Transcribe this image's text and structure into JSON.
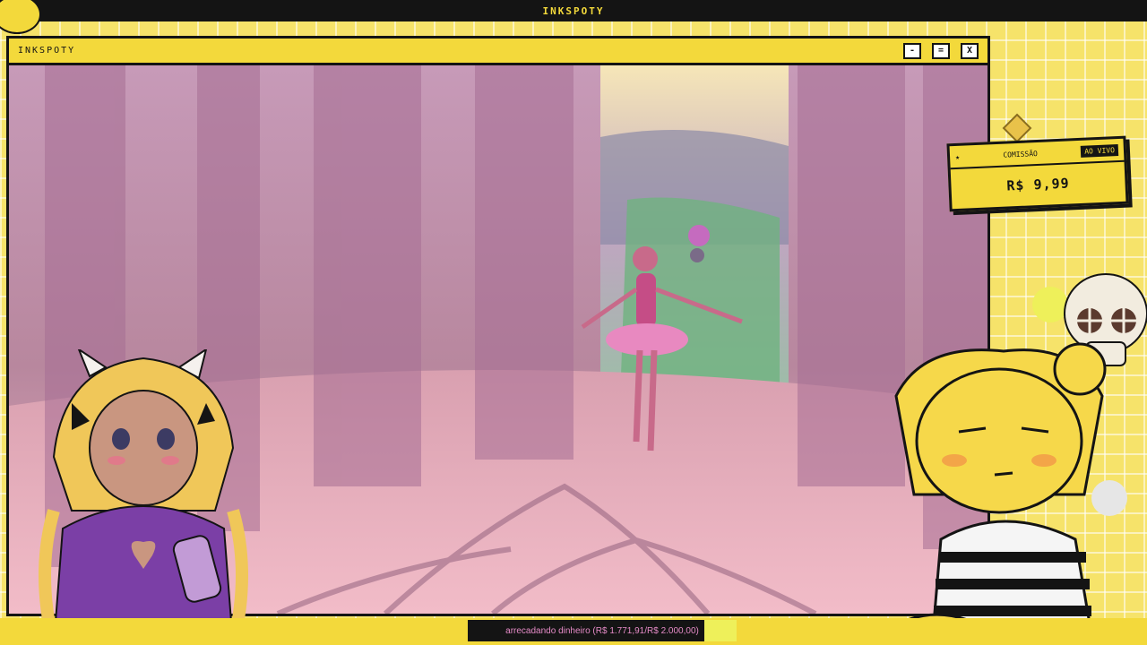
{
  "topbar": {
    "title": "INKSPOTY"
  },
  "window": {
    "title": "INKSPOTY",
    "buttons": {
      "minimize": "-",
      "maximize": "=",
      "close": "X"
    }
  },
  "commission": {
    "label": "COMISSÃO",
    "status": "AO VIVO",
    "price": "R$ 9,99",
    "star": "★"
  },
  "goal": {
    "text": "arrecadando dinheiro (R$ 1.771,91/R$ 2.000,00)",
    "progress": 0.886
  },
  "colors": {
    "accent": "#f3d93b",
    "dark": "#141414",
    "goal_text": "#e58bc7",
    "goal_fill": "#eef05a"
  }
}
